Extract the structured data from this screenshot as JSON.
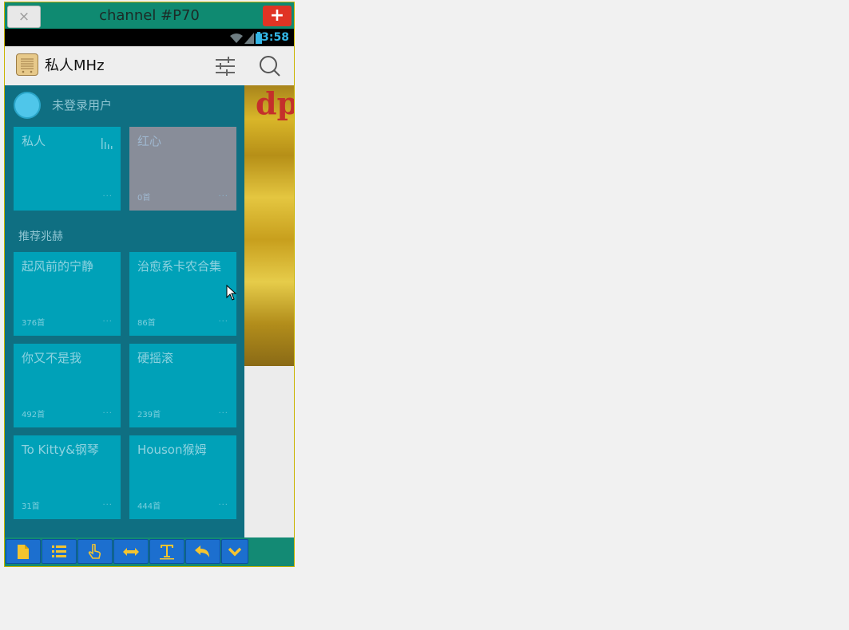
{
  "window": {
    "title": "channel #P70",
    "close_label": "×",
    "add_label": "+"
  },
  "status_bar": {
    "time": "3:58",
    "icons": [
      "wifi-icon",
      "signal-icon",
      "battery-icon"
    ]
  },
  "app_bar": {
    "title": "私人MHz",
    "icons": [
      "radio-logo-icon",
      "filter-sliders-icon",
      "search-icon"
    ]
  },
  "drawer": {
    "user_name": "未登录用户",
    "top_tiles": [
      {
        "title": "私人",
        "count": "",
        "more": "···",
        "icon": "equalizer-icon"
      },
      {
        "title": "红心",
        "count": "0首",
        "more": "···"
      }
    ],
    "section_title": "推荐兆赫",
    "tiles": [
      {
        "title": "起风前的宁静",
        "count": "376首",
        "more": "···"
      },
      {
        "title": "治愈系卡农合集",
        "count": "86首",
        "more": "···"
      },
      {
        "title": "你又不是我",
        "count": "492首",
        "more": "···"
      },
      {
        "title": "硬摇滚",
        "count": "239首",
        "more": "···"
      },
      {
        "title": "To Kitty&钢琴",
        "count": "31首",
        "more": "···"
      },
      {
        "title": "Houson猴姆",
        "count": "444首",
        "more": "···"
      }
    ]
  },
  "toolbar": {
    "buttons": [
      "file-icon",
      "list-icon",
      "touch-icon",
      "swap-horizontal-icon",
      "text-icon",
      "undo-icon",
      "chevron-down-icon"
    ]
  },
  "colors": {
    "title_bar": "#0f8a71",
    "drawer_bg": "#0f6f82",
    "tile_bg": "#00a1b8",
    "tile_selected": "#888d99",
    "toolbar_button": "#1c6fcf",
    "status_accent": "#33b5e5"
  }
}
